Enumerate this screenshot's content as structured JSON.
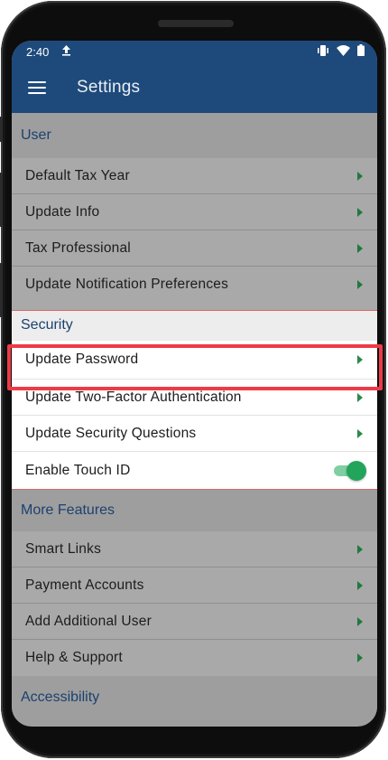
{
  "status_bar": {
    "time": "2:40",
    "icons": [
      "upload-icon",
      "vibrate-icon",
      "wifi-icon",
      "battery-icon"
    ]
  },
  "app_bar": {
    "title": "Settings",
    "menu_icon": "hamburger-menu-icon"
  },
  "sections": {
    "user": {
      "header": "User",
      "items": [
        "Default Tax Year",
        "Update Info",
        "Tax Professional",
        "Update Notification Preferences"
      ]
    },
    "security": {
      "header": "Security",
      "items": [
        "Update Password",
        "Update Two-Factor Authentication",
        "Update Security Questions"
      ],
      "toggle_label": "Enable Touch ID",
      "toggle_on": true
    },
    "more_features": {
      "header": "More Features",
      "items": [
        "Smart Links",
        "Payment Accounts",
        "Add Additional User",
        "Help & Support"
      ]
    },
    "accessibility": {
      "header": "Accessibility"
    }
  },
  "colors": {
    "app_bar": "#1e4a7b",
    "section_text": "#1b4170",
    "chevron": "#2a8a4a",
    "toggle": "#22a55b",
    "highlight": "#ef3a47"
  }
}
